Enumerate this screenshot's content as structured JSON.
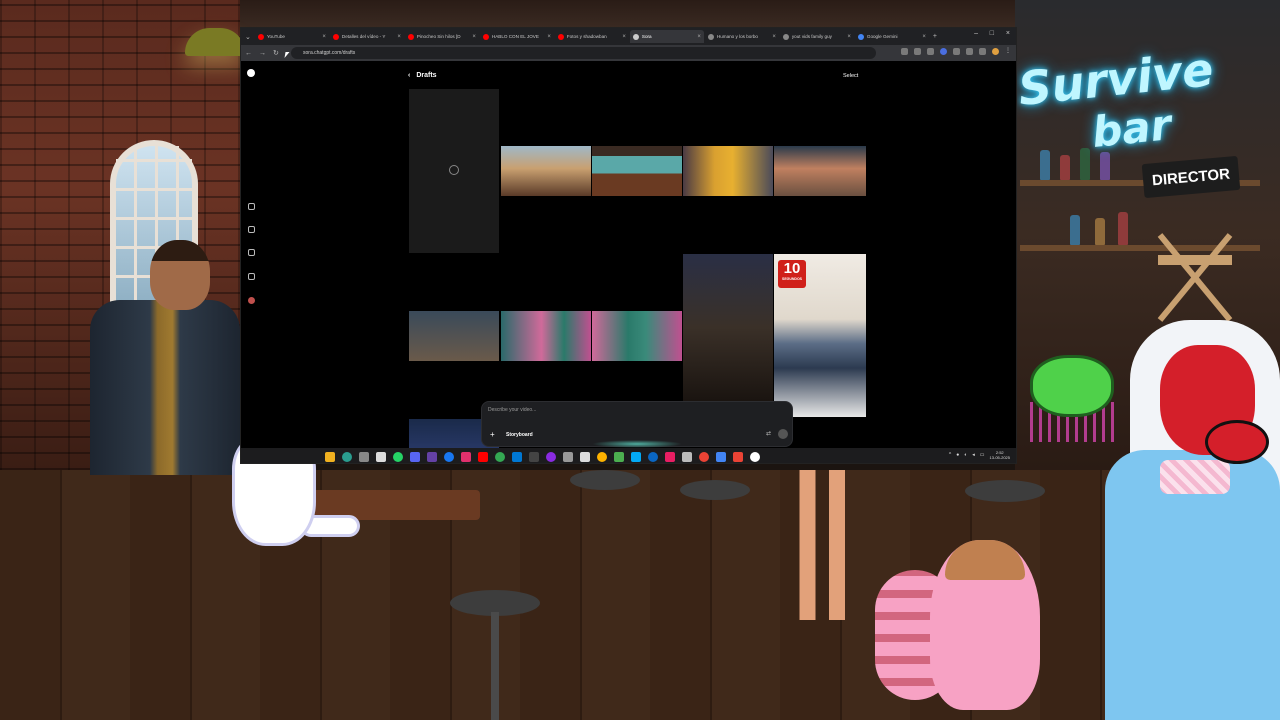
{
  "scene": {
    "neon_line1": "Survive",
    "neon_line2": "bar",
    "director_sign": "DIRECTOR"
  },
  "browser": {
    "tabs": [
      {
        "title": "YouTube",
        "color": "#ff0000",
        "active": false
      },
      {
        "title": "Detalles del vídeo - Y",
        "color": "#ff0000",
        "active": false
      },
      {
        "title": "Pinocheo Sin hilos [D",
        "color": "#ff0000",
        "active": false
      },
      {
        "title": "HABLO CON EL JOVE",
        "color": "#ff0000",
        "active": false
      },
      {
        "title": "Fotos y shadowban",
        "color": "#ff0000",
        "active": false
      },
      {
        "title": "Sora",
        "color": "#cccccc",
        "active": true
      },
      {
        "title": "Humano y los borbo",
        "color": "#888888",
        "active": false
      },
      {
        "title": "yout vids family guy",
        "color": "#888888",
        "active": false
      },
      {
        "title": "Google Gemini",
        "color": "#4285f4",
        "active": false
      }
    ],
    "new_tab": "+",
    "url": "sora.chatgpt.com/drafts",
    "window_controls": [
      "–",
      "□",
      "×"
    ]
  },
  "sora": {
    "page_title": "Drafts",
    "back_label": "‹",
    "select_label": "Select",
    "badge_number": "10",
    "badge_sub": "SEGUNDOS",
    "composer_placeholder": "Describe your video...",
    "composer_plus": "+",
    "composer_storyboard": "Storyboard",
    "sidebar_icons": [
      "explore-icon",
      "search-icon",
      "bulb-icon",
      "bell-icon",
      "avatar-icon"
    ]
  },
  "taskbar": {
    "icon_colors": [
      "#f0b020",
      "#2a9d8f",
      "#888888",
      "#dddddd",
      "#25d366",
      "#5865f2",
      "#6441a5",
      "#1877f2",
      "#e1306c",
      "#ff0000",
      "#34a853",
      "#0078d4",
      "#444444",
      "#8a2be2",
      "#999999",
      "#dddddd",
      "#ffb300",
      "#4caf50",
      "#03a9f4",
      "#0a66c2",
      "#e91e63",
      "#bbbbbb",
      "#ea4335",
      "#4285f4",
      "#ea4335",
      "#ffffff"
    ],
    "time": "2:52",
    "date": "13-05-2025",
    "tray_chevron": "^"
  }
}
